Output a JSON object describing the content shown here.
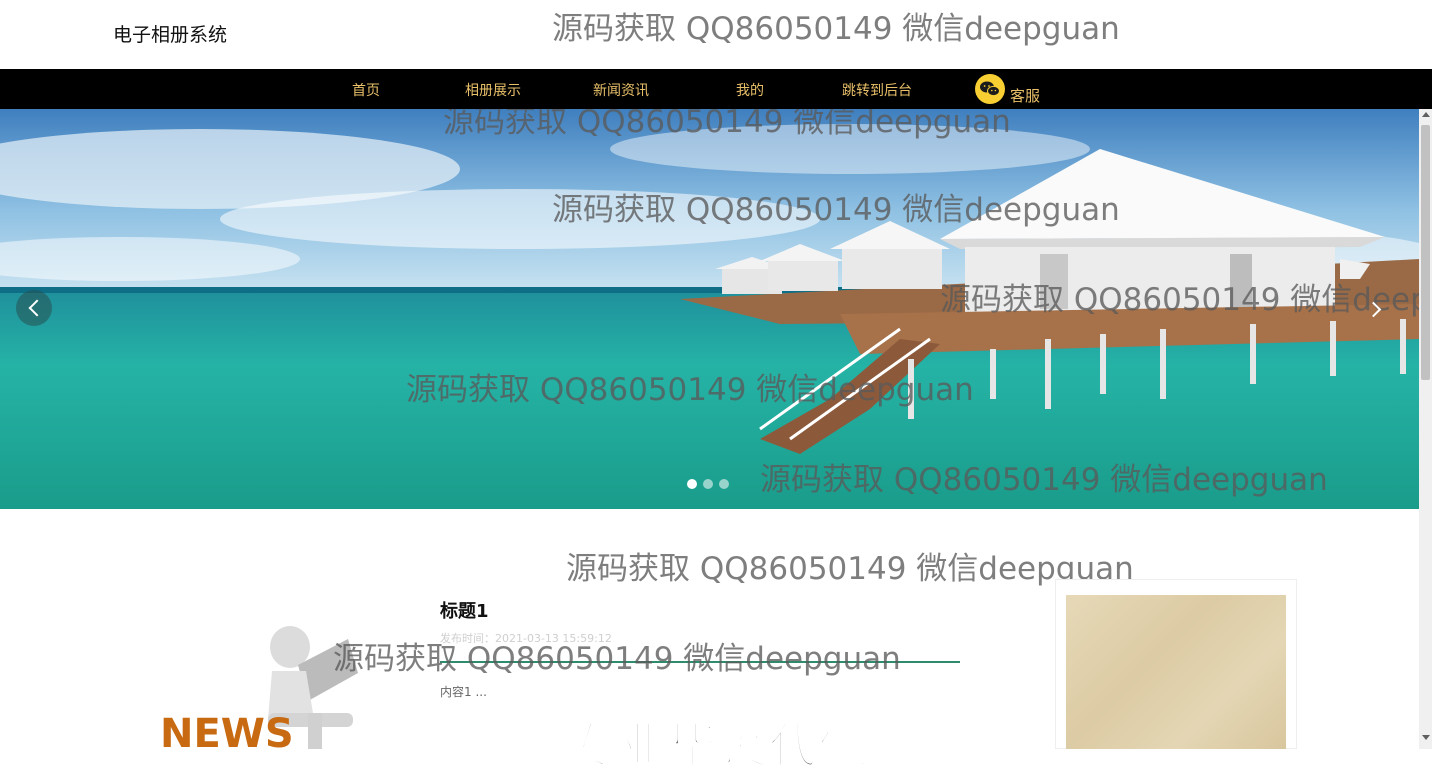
{
  "header": {
    "site_title": "电子相册系统"
  },
  "nav": {
    "items": [
      {
        "label": "首页"
      },
      {
        "label": "相册展示"
      },
      {
        "label": "新闻资讯"
      },
      {
        "label": "我的"
      },
      {
        "label": "跳转到后台"
      }
    ],
    "service_label": "客服"
  },
  "watermark": {
    "text": "源码获取 QQ86050149 微信deepguan"
  },
  "carousel": {
    "slide_count": 3,
    "active_index": 0
  },
  "news": {
    "title": "标题1",
    "published": "发布时间：2021-03-13 15:59:12",
    "content": "内容1 ..."
  },
  "promo": {
    "text": "专业毕设代做"
  },
  "colors": {
    "nav_bg": "#000000",
    "nav_text": "#e9c06a",
    "accent_line": "#2e8b6b",
    "wechat_icon": "#f7cf32"
  }
}
